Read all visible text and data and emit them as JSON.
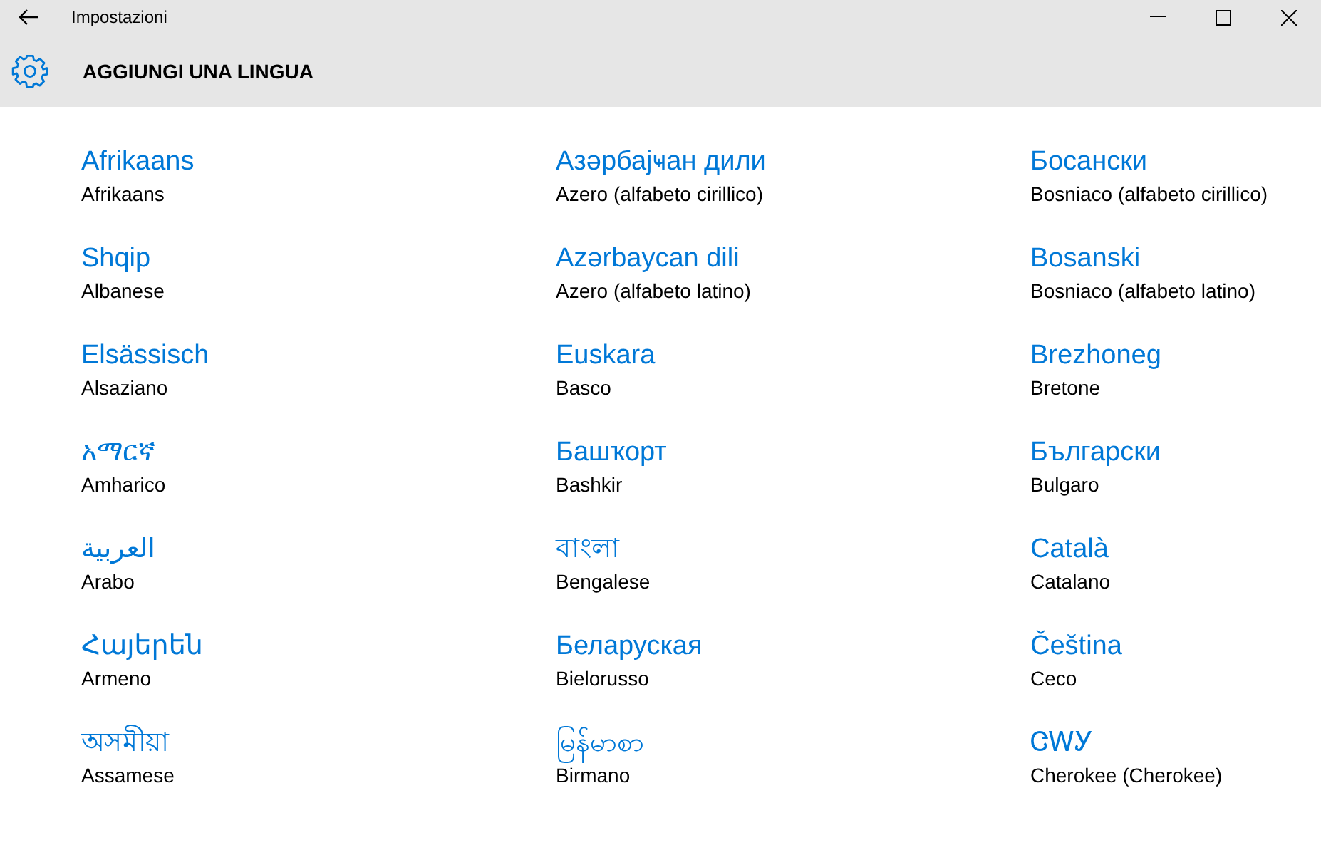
{
  "window": {
    "title": "Impostazioni"
  },
  "header": {
    "title": "AGGIUNGI UNA LINGUA"
  },
  "languages": [
    {
      "native": "Afrikaans",
      "name": "Afrikaans"
    },
    {
      "native": "Shqip",
      "name": "Albanese"
    },
    {
      "native": "Elsässisch",
      "name": "Alsaziano"
    },
    {
      "native": "አማርኛ",
      "name": "Amharico"
    },
    {
      "native": "العربية",
      "name": "Arabo"
    },
    {
      "native": "Հայերեն",
      "name": "Armeno"
    },
    {
      "native": "অসমীয়া",
      "name": "Assamese"
    },
    {
      "native": "Азәрбајҹан дили",
      "name": "Azero (alfabeto cirillico)"
    },
    {
      "native": "Azərbaycan dili",
      "name": "Azero (alfabeto latino)"
    },
    {
      "native": "Euskara",
      "name": "Basco"
    },
    {
      "native": "Башҡорт",
      "name": "Bashkir"
    },
    {
      "native": "বাংলা",
      "name": "Bengalese"
    },
    {
      "native": "Беларуская",
      "name": "Bielorusso"
    },
    {
      "native": "မြန်မာစာ",
      "name": "Birmano"
    },
    {
      "native": "Босански",
      "name": "Bosniaco (alfabeto cirillico)"
    },
    {
      "native": "Bosanski",
      "name": "Bosniaco (alfabeto latino)"
    },
    {
      "native": "Brezhoneg",
      "name": "Bretone"
    },
    {
      "native": "Български",
      "name": "Bulgaro"
    },
    {
      "native": "Català",
      "name": "Catalano"
    },
    {
      "native": "Čeština",
      "name": "Ceco"
    },
    {
      "native": "ᏣᎳᎩ",
      "name": "Cherokee (Cherokee)"
    }
  ]
}
